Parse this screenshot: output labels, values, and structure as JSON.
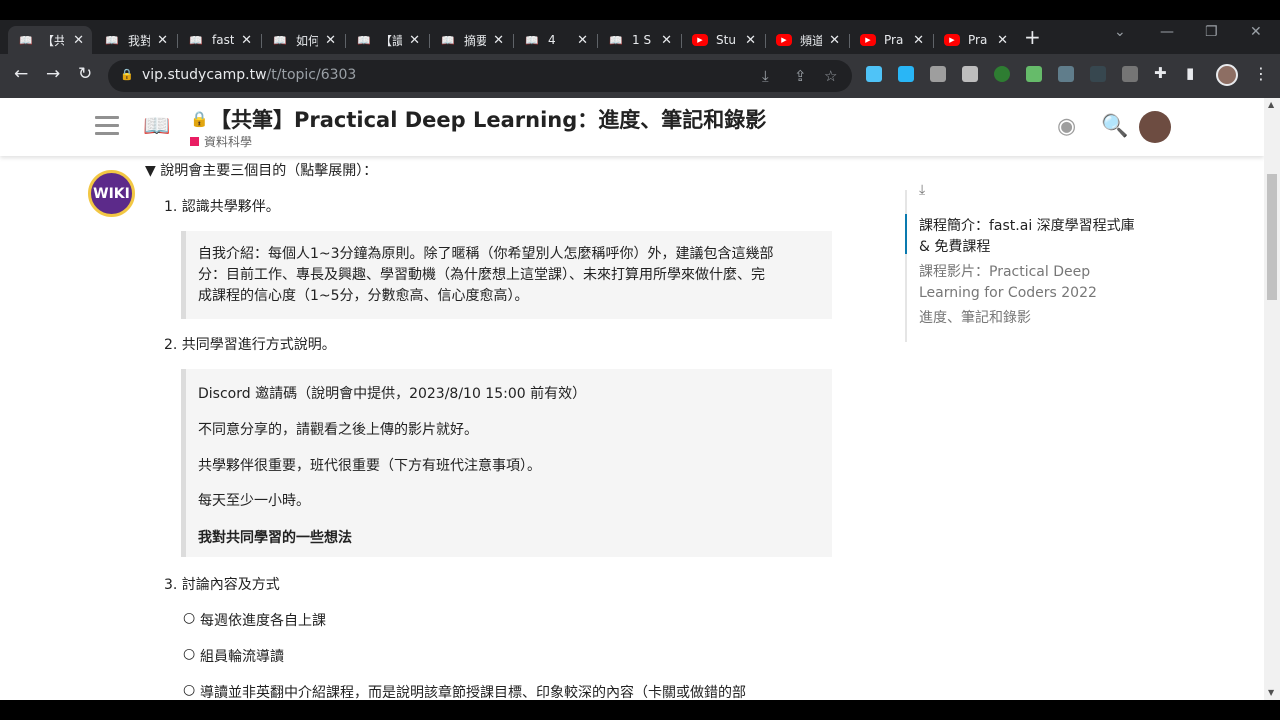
{
  "browser": {
    "tabs": [
      {
        "title": "【共",
        "favicon": "book-icon"
      },
      {
        "title": "我對",
        "favicon": "book-icon"
      },
      {
        "title": "fast",
        "favicon": "book-icon"
      },
      {
        "title": "如何",
        "favicon": "book-icon"
      },
      {
        "title": "【讀",
        "favicon": "book-icon"
      },
      {
        "title": "摘要",
        "favicon": "book-icon"
      },
      {
        "title": "4",
        "favicon": "book-icon"
      },
      {
        "title": "1 S",
        "favicon": "book-icon"
      },
      {
        "title": "Stu",
        "favicon": "youtube-icon"
      },
      {
        "title": "頻道",
        "favicon": "youtube-icon"
      },
      {
        "title": "Pra",
        "favicon": "youtube-icon"
      },
      {
        "title": "Pra",
        "favicon": "youtube-icon"
      }
    ],
    "url_host": "vip.studycamp.tw",
    "url_path": "/t/topic/6303"
  },
  "header": {
    "title": "【共筆】Practical Deep Learning：進度、筆記和錄影",
    "category": "資料科學",
    "category_color": "#e91e63"
  },
  "post": {
    "summary": "▼ 說明會主要三個目的（點擊展開）：",
    "item1": "1. 認識共學夥伴。",
    "quote1_l1": "自我介紹：每個人1~3分鐘為原則。除了暱稱（你希望別人怎麼稱呼你）外，建議包含這幾部",
    "quote1_l2": "分：目前工作、專長及興趣、學習動機（為什麼想上這堂課）、未來打算用所學來做什麼、完",
    "quote1_l3": "成課程的信心度（1~5分，分數愈高、信心度愈高）。",
    "item2": "2. 共同學習進行方式說明。",
    "quote2_l1": "Discord 邀請碼（說明會中提供，2023/8/10 15:00 前有效）",
    "quote2_l2": "不同意分享的，請觀看之後上傳的影片就好。",
    "quote2_l3": "共學夥伴很重要，班代很重要（下方有班代注意事項）。",
    "quote2_l4": "每天至少一小時。",
    "quote2_link": "我對共同學習的一些想法",
    "item3": "3. 討論內容及方式",
    "sub1": "每週依進度各自上課",
    "sub2": "組員輪流導讀",
    "sub3": "導讀並非英翻中介紹課程，而是說明該章節授課目標、印象較深的內容（卡關或做錯的部"
  },
  "toc": {
    "items": [
      "課程簡介：fast.ai 深度學習程式庫 & 免費課程",
      "課程影片：Practical Deep Learning for Coders 2022",
      "進度、筆記和錄影"
    ]
  },
  "wiki_badge": "WIKI",
  "accent": "#0a7aaf"
}
